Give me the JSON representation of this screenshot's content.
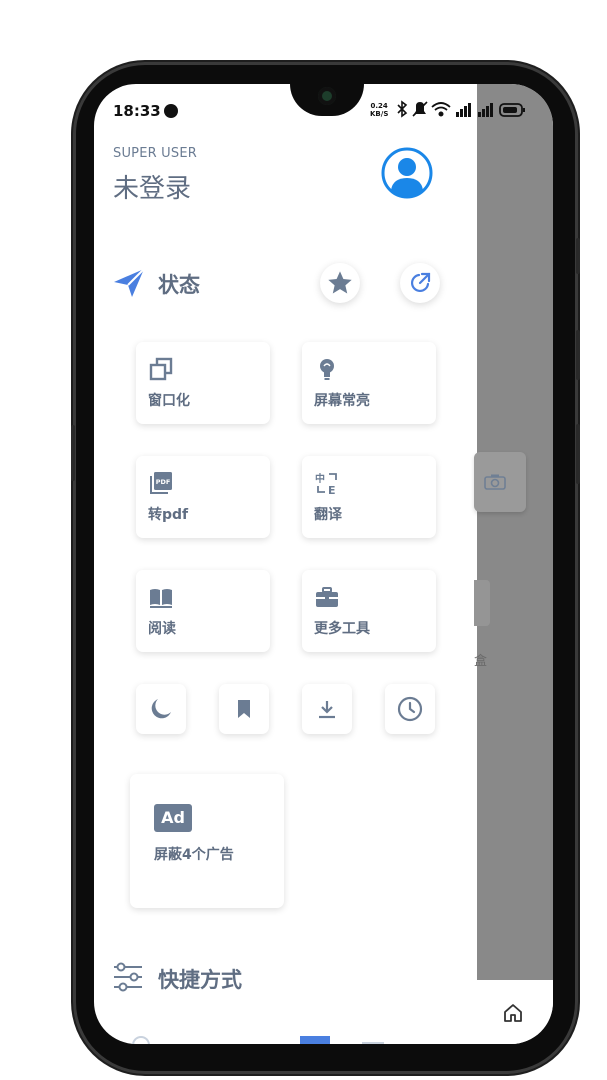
{
  "status_bar": {
    "time": "18:33",
    "speed_value": "0.24",
    "speed_unit": "KB/S"
  },
  "drawer": {
    "account_type": "SUPER USER",
    "user_name": "未登录",
    "status_section": {
      "title": "状态",
      "icon": "paper-plane-icon",
      "actions": [
        {
          "icon": "star-icon"
        },
        {
          "icon": "share-icon"
        }
      ]
    },
    "tools": [
      {
        "label": "窗口化",
        "icon": "window-icon"
      },
      {
        "label": "屏幕常亮",
        "icon": "bulb-icon"
      },
      {
        "label": "转pdf",
        "icon": "pdf-icon"
      },
      {
        "label": "翻译",
        "icon": "translate-icon"
      },
      {
        "label": "阅读",
        "icon": "book-icon"
      },
      {
        "label": "更多工具",
        "icon": "toolbox-icon"
      }
    ],
    "small_buttons": [
      {
        "icon": "moon-icon"
      },
      {
        "icon": "bookmark-icon"
      },
      {
        "icon": "download-icon"
      },
      {
        "icon": "history-icon"
      }
    ],
    "ad_block": {
      "badge": "Ad",
      "label": "屏蔽4个广告"
    },
    "shortcuts_section": {
      "title": "快捷方式",
      "icon": "sliders-icon"
    }
  },
  "background_page": {
    "partial_text": "盒"
  },
  "colors": {
    "accent": "#4a7fe0",
    "label": "#5f6d82",
    "icon": "#6b7c93",
    "overlay": "#898989"
  }
}
